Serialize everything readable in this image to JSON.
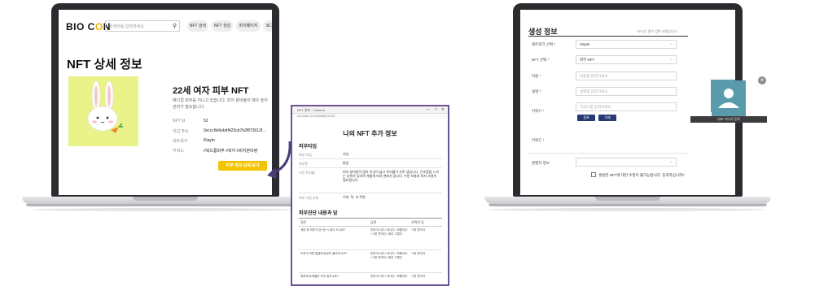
{
  "left_screen": {
    "logo": {
      "part1": "BIO C",
      "part2": "O",
      "part3": "N"
    },
    "search": {
      "placeholder": "검색어를 입력하세요"
    },
    "nav": [
      "NFT 검색",
      "NFT 생성",
      "마이페이지",
      "로그아웃"
    ],
    "page_title": "NFT 상세 정보",
    "nft": {
      "title": "22세 여자 피부 NFT",
      "description": "메디컬 피부를 지니고 있습니다. 피지 분비율이 매우 높아 관리가 필요합니다.",
      "rows": [
        {
          "label": "NFT Id",
          "value": "52"
        },
        {
          "label": "지갑 주소",
          "value": "0xccc6b6ebdf423cb7b2f873012f..."
        },
        {
          "label": "네트워크",
          "value": "Klaytn"
        },
        {
          "label": "키워드",
          "value": "#복드름피부    #피지    #피지분비량"
        }
      ],
      "detail_button": "피부 정보 상세 보기"
    }
  },
  "popup": {
    "window_title": "NFT 정보 · Chrome",
    "address": "bio-chain.com/nft/detail?id=52",
    "title": "나의 NFT 추가 정보",
    "section1": "피부타입",
    "fields": [
      {
        "label": "피부 타입",
        "value": "지성"
      },
      {
        "label": "피부톤",
        "value": "밝음"
      },
      {
        "label": "스킨 트러블",
        "value": "피지 분비량이 많아 모공이 넓고 트러블이 자주 생깁니다. 건조함을 느끼는 부위가 있으며 계절에 따라 변화가 큽니다. 수분 보충과 피지 조절이 필요합니다."
      },
      {
        "label": "피부 고민 부위",
        "value": "이마, 턱, 코 주변"
      }
    ],
    "section2": "피부진단 내용과 답",
    "table_headers": [
      "질문",
      "답변",
      "선택한 답"
    ],
    "table_rows": [
      {
        "q": "세안 후 피부가 당기는 느낌이 드나요?",
        "a": "전혀 아니다 / 아니다 / 보통이다 / 그런 편이다 / 매우 그렇다",
        "s": "그런 편이다"
      },
      {
        "q": "오후가 되면 얼굴에 유분이 올라오나요?",
        "a": "전혀 아니다 / 아니다 / 보통이다 / 그런 편이다 / 매우 그렇다",
        "s": "그런 편이다"
      },
      {
        "q": "피부에 트러블이 자주 생기나요?",
        "a": "전혀 아니다 / 아니다 / 보통이다",
        "s": "그런 편이다"
      }
    ]
  },
  "right_screen": {
    "title": "생성 정보",
    "required_note": "* 표시는 필수 입력 사항입니다.",
    "fields": [
      {
        "label": "네트워크 선택 *",
        "value": "Klaytn",
        "kind": "select"
      },
      {
        "label": "NFT 선택 *",
        "value": "피부 NFT",
        "kind": "select"
      },
      {
        "label": "이름 *",
        "value": "이름을 입력하세요",
        "kind": "input"
      },
      {
        "label": "설명 *",
        "value": "설명을 입력하세요",
        "kind": "input"
      },
      {
        "label": "키워드 *",
        "value": "키워드를 입력하세요",
        "kind": "input"
      }
    ],
    "keyword_buttons": {
      "register": "등록",
      "delete": "삭제"
    },
    "keyword_list_label": "키워드 *",
    "owner_label": "발행자 정보",
    "consent_text": "생성한 NFT에 대한 수정이 불가능합니다. 동의하십니까?",
    "image_caption": "대표 이미지 등록"
  },
  "colors": {
    "accent": "#f5c400",
    "navy": "#263a73",
    "popup_border": "#6a5496",
    "nft_bg": "#e9f38a"
  }
}
